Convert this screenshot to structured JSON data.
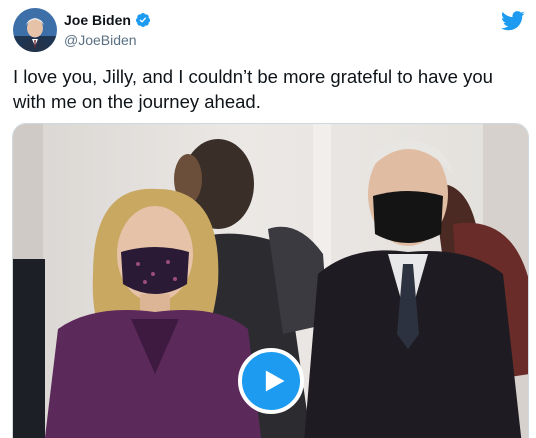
{
  "tweet": {
    "display_name": "Joe Biden",
    "handle": "@JoeBiden",
    "verified": true,
    "text": "I love you, Jilly, and I couldn’t be more grateful to have you with me on the journey ahead."
  },
  "icons": {
    "verified": "verified-badge-icon",
    "twitter": "twitter-bird-icon",
    "play": "play-icon"
  },
  "colors": {
    "accent": "#1d9bf0",
    "text": "#0f1419",
    "secondary_text": "#5b7083"
  }
}
